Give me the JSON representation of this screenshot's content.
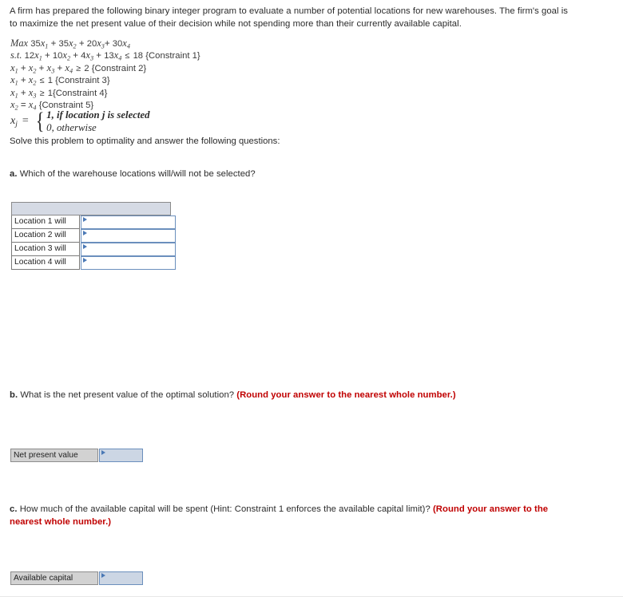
{
  "problem": {
    "intro": "A firm has prepared the following binary integer program to evaluate a number of potential locations for new warehouses. The firm's goal is to maximize the net present value of their decision while not spending more than their currently available capital.",
    "objective": {
      "keyword": "Max",
      "terms": [
        "35x1",
        "35x2",
        "20x3",
        "30x4"
      ],
      "text": "Max 35x1 + 35x2 + 20x3 + 30x4"
    },
    "constraints": [
      {
        "prefix": "s.t.",
        "lhs": "12x1 + 10x2 + 4x3 + 13x4",
        "rel": "≤",
        "rhs": "18",
        "label": "{Constraint 1}"
      },
      {
        "prefix": "",
        "lhs": "x1 + x2 + x3 + x4",
        "rel": "≥",
        "rhs": "2",
        "label": "{Constraint 2}"
      },
      {
        "prefix": "",
        "lhs": "x1 + x2",
        "rel": "≤",
        "rhs": "1",
        "label": "{Constraint 3}"
      },
      {
        "prefix": "",
        "lhs": "x1 + x3",
        "rel": "≥",
        "rhs": "1",
        "label": "{Constraint 4}"
      },
      {
        "prefix": "",
        "lhs": "x2",
        "rel": "=",
        "rhs": "x4",
        "label": "{Constraint 5}"
      }
    ],
    "definition": {
      "variable": "x",
      "subscript": "j",
      "equals": "=",
      "case_one": "1, if location j is selected",
      "case_one_num": "1,",
      "case_one_text": "if location j is selected",
      "case_zero_num": "0,",
      "case_zero_text": "otherwise"
    },
    "solve_instruction": "Solve this problem to optimality and answer the following questions:"
  },
  "part_a": {
    "letter": "a.",
    "prompt": "Which of the warehouse locations will/will not be selected?",
    "header_label": "",
    "rows": [
      {
        "label": "Location 1 will",
        "value": "",
        "placeholder": ""
      },
      {
        "label": "Location 2 will",
        "value": "",
        "placeholder": ""
      },
      {
        "label": "Location 3 will",
        "value": "",
        "placeholder": ""
      },
      {
        "label": "Location 4 will",
        "value": "",
        "placeholder": ""
      }
    ]
  },
  "part_b": {
    "letter": "b.",
    "prompt": "What is the net present value of the optimal solution?",
    "note": "(Round your answer to the nearest whole number.)",
    "field": {
      "label": "Net present value",
      "value": ""
    }
  },
  "part_c": {
    "letter": "c.",
    "prompt": "How much of the available capital will be spent (Hint: Constraint 1 enforces the available capital limit)?",
    "note": "(Round your answer to the nearest whole number.)",
    "field": {
      "label": "Available capital",
      "value": ""
    }
  },
  "colors": {
    "note_red": "#c00000",
    "header_fill": "#d5dae4",
    "label_fill": "#d2d2d2",
    "input_fill": "#ccd6e4",
    "input_border": "#6b8fbd",
    "caret": "#4a78b5"
  }
}
